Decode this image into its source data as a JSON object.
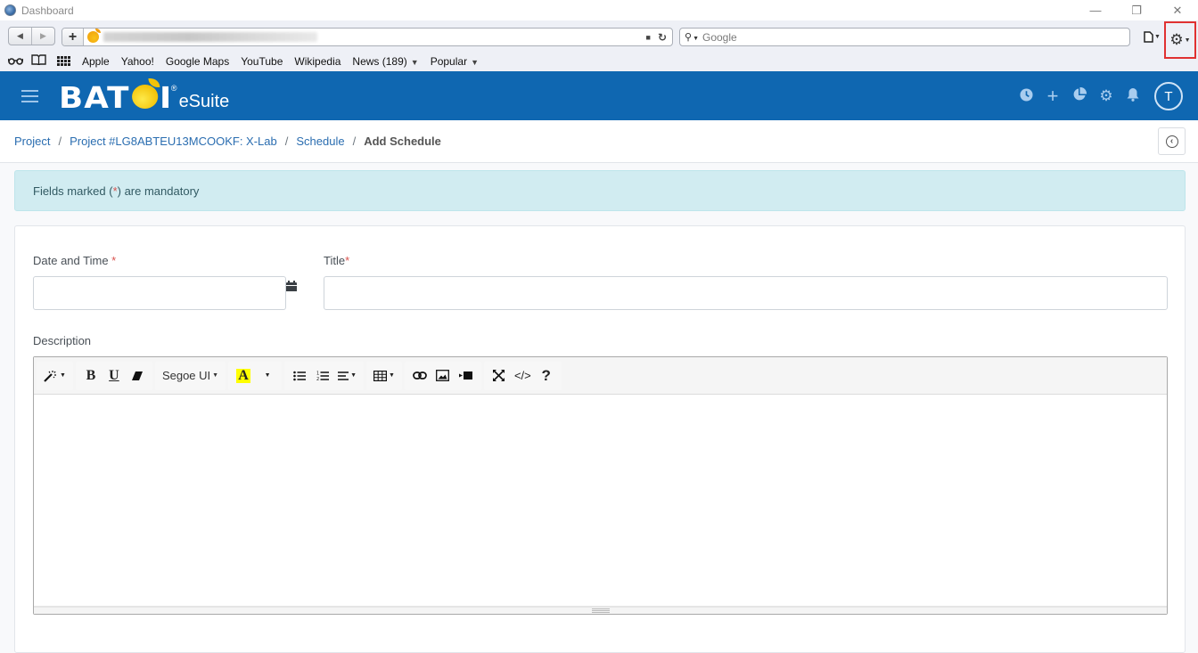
{
  "window": {
    "title": "Dashboard",
    "controls": {
      "minimize": "—",
      "restore": "❐",
      "close": "✕"
    }
  },
  "browser": {
    "back_icon": "◀",
    "forward_icon": "▶",
    "new_tab_icon": "+",
    "url": "",
    "lock_icon": "🔒",
    "reload_icon": "↻",
    "search": {
      "placeholder": "Google",
      "value": ""
    },
    "page_menu_icon": "🗋",
    "settings_icon": "⚙",
    "bookmarks_bar": {
      "reader_icon": "👓",
      "bookmarks_icon": "📖",
      "items": [
        {
          "label": "Apple"
        },
        {
          "label": "Yahoo!"
        },
        {
          "label": "Google Maps"
        },
        {
          "label": "YouTube"
        },
        {
          "label": "Wikipedia"
        },
        {
          "label": "News (189)",
          "dropdown": true
        },
        {
          "label": "Popular",
          "dropdown": true
        }
      ]
    }
  },
  "app": {
    "brand": "BAT",
    "brand_suffix": "I",
    "reg_mark": "®",
    "product": "eSuite",
    "header_icons": [
      "clock-icon",
      "plus-icon",
      "pie-chart-icon",
      "gear-icon",
      "bell-icon"
    ],
    "header_glyphs": {
      "clock": "◷",
      "plus": "+",
      "pie": "◕",
      "gear": "⚙",
      "bell": "🔔"
    },
    "user_initial": "T",
    "accent_color": "#0f67b1"
  },
  "breadcrumb": {
    "items": [
      {
        "label": "Project"
      },
      {
        "label": "Project #LG8ABTEU13MCOOKF: X-Lab"
      },
      {
        "label": "Schedule"
      }
    ],
    "current": "Add Schedule",
    "separator": "/",
    "back_glyph": "‹"
  },
  "alert": {
    "text_before": "Fields marked (",
    "asterisk": "*",
    "text_after": ") are mandatory"
  },
  "form": {
    "date_time": {
      "label": "Date and Time",
      "required_mark": "*",
      "value": "",
      "placeholder": ""
    },
    "title": {
      "label": "Title",
      "required_mark": "*",
      "value": "",
      "placeholder": ""
    },
    "description": {
      "label": "Description",
      "value": ""
    }
  },
  "editor_toolbar": {
    "style": "✎",
    "bold": "B",
    "underline": "U",
    "clear_format": "⌫",
    "font_name": "Segoe UI",
    "highlight": "A",
    "unordered_list": "☰",
    "ordered_list": "☷",
    "paragraph": "≡",
    "table": "▦",
    "link": "🔗",
    "picture": "🖼",
    "video": "▶",
    "fullscreen": "⤧",
    "code_view": "</>",
    "help": "?"
  }
}
